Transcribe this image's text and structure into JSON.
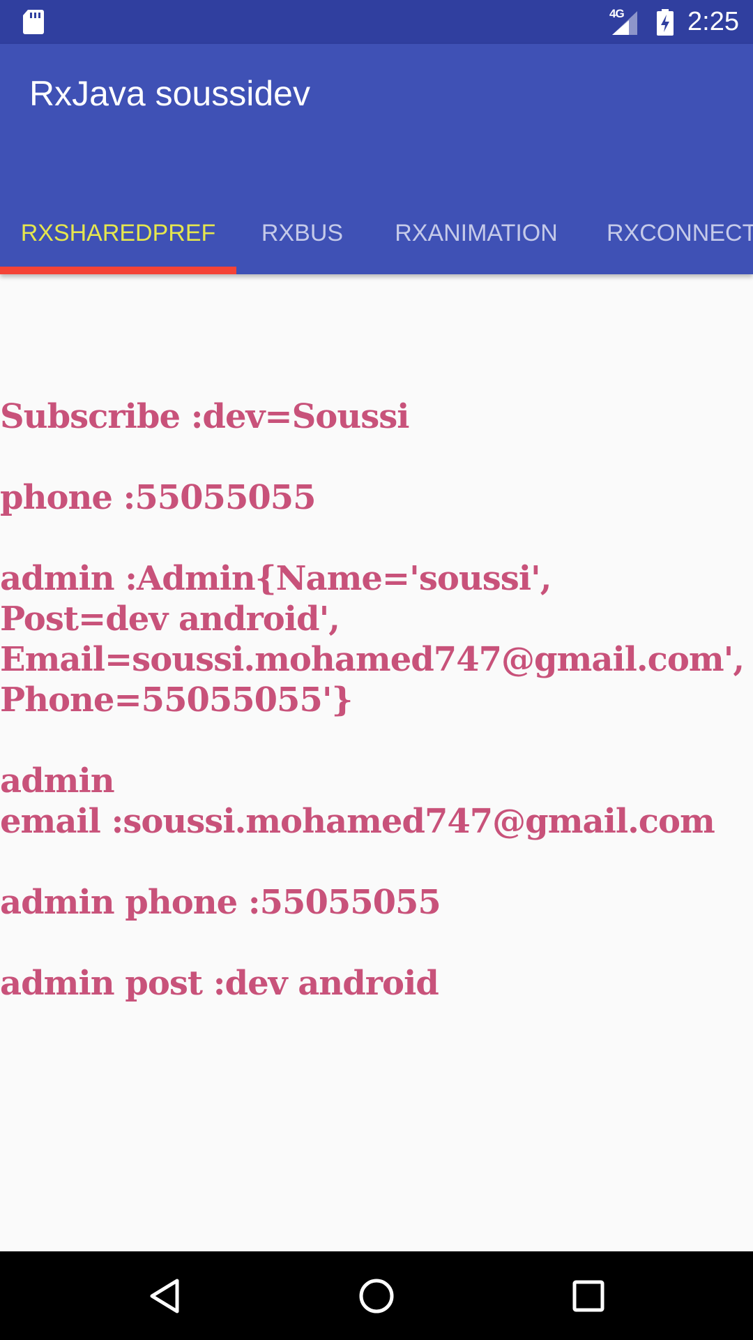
{
  "status_bar": {
    "network_type": "4G",
    "time": "2:25",
    "left_icon": "sd-card-icon",
    "battery_icon": "battery-charging-icon",
    "signal_icon": "cell-signal-icon"
  },
  "app_bar": {
    "title": "RxJava soussidev",
    "tabs": [
      {
        "label": "RXSHAREDPREF",
        "active": true
      },
      {
        "label": "RXBUS",
        "active": false
      },
      {
        "label": "RXANIMATION",
        "active": false
      },
      {
        "label": "RXCONNECTI",
        "active": false
      }
    ]
  },
  "content": {
    "text": "Subscribe :dev=Soussi\n\nphone :55055055\n\nadmin :Admin{Name='soussi',\nPost=dev android',\nEmail=soussi.mohamed747@gmail.com',\nPhone=55055055'}\n\nadmin\nemail :soussi.mohamed747@gmail.com\n\nadmin phone :55055055\n\nadmin post :dev android"
  },
  "nav_bar": {
    "back_icon": "back-triangle-icon",
    "home_icon": "home-circle-icon",
    "recents_icon": "recents-square-icon"
  },
  "colors": {
    "status_bar": "#303f9f",
    "app_bar": "#3f51b5",
    "active_tab": "#e5e64e",
    "inactive_tab": "#c5cae9",
    "indicator": "#f44336",
    "content_text": "#c8527a",
    "background": "#fafafa"
  }
}
